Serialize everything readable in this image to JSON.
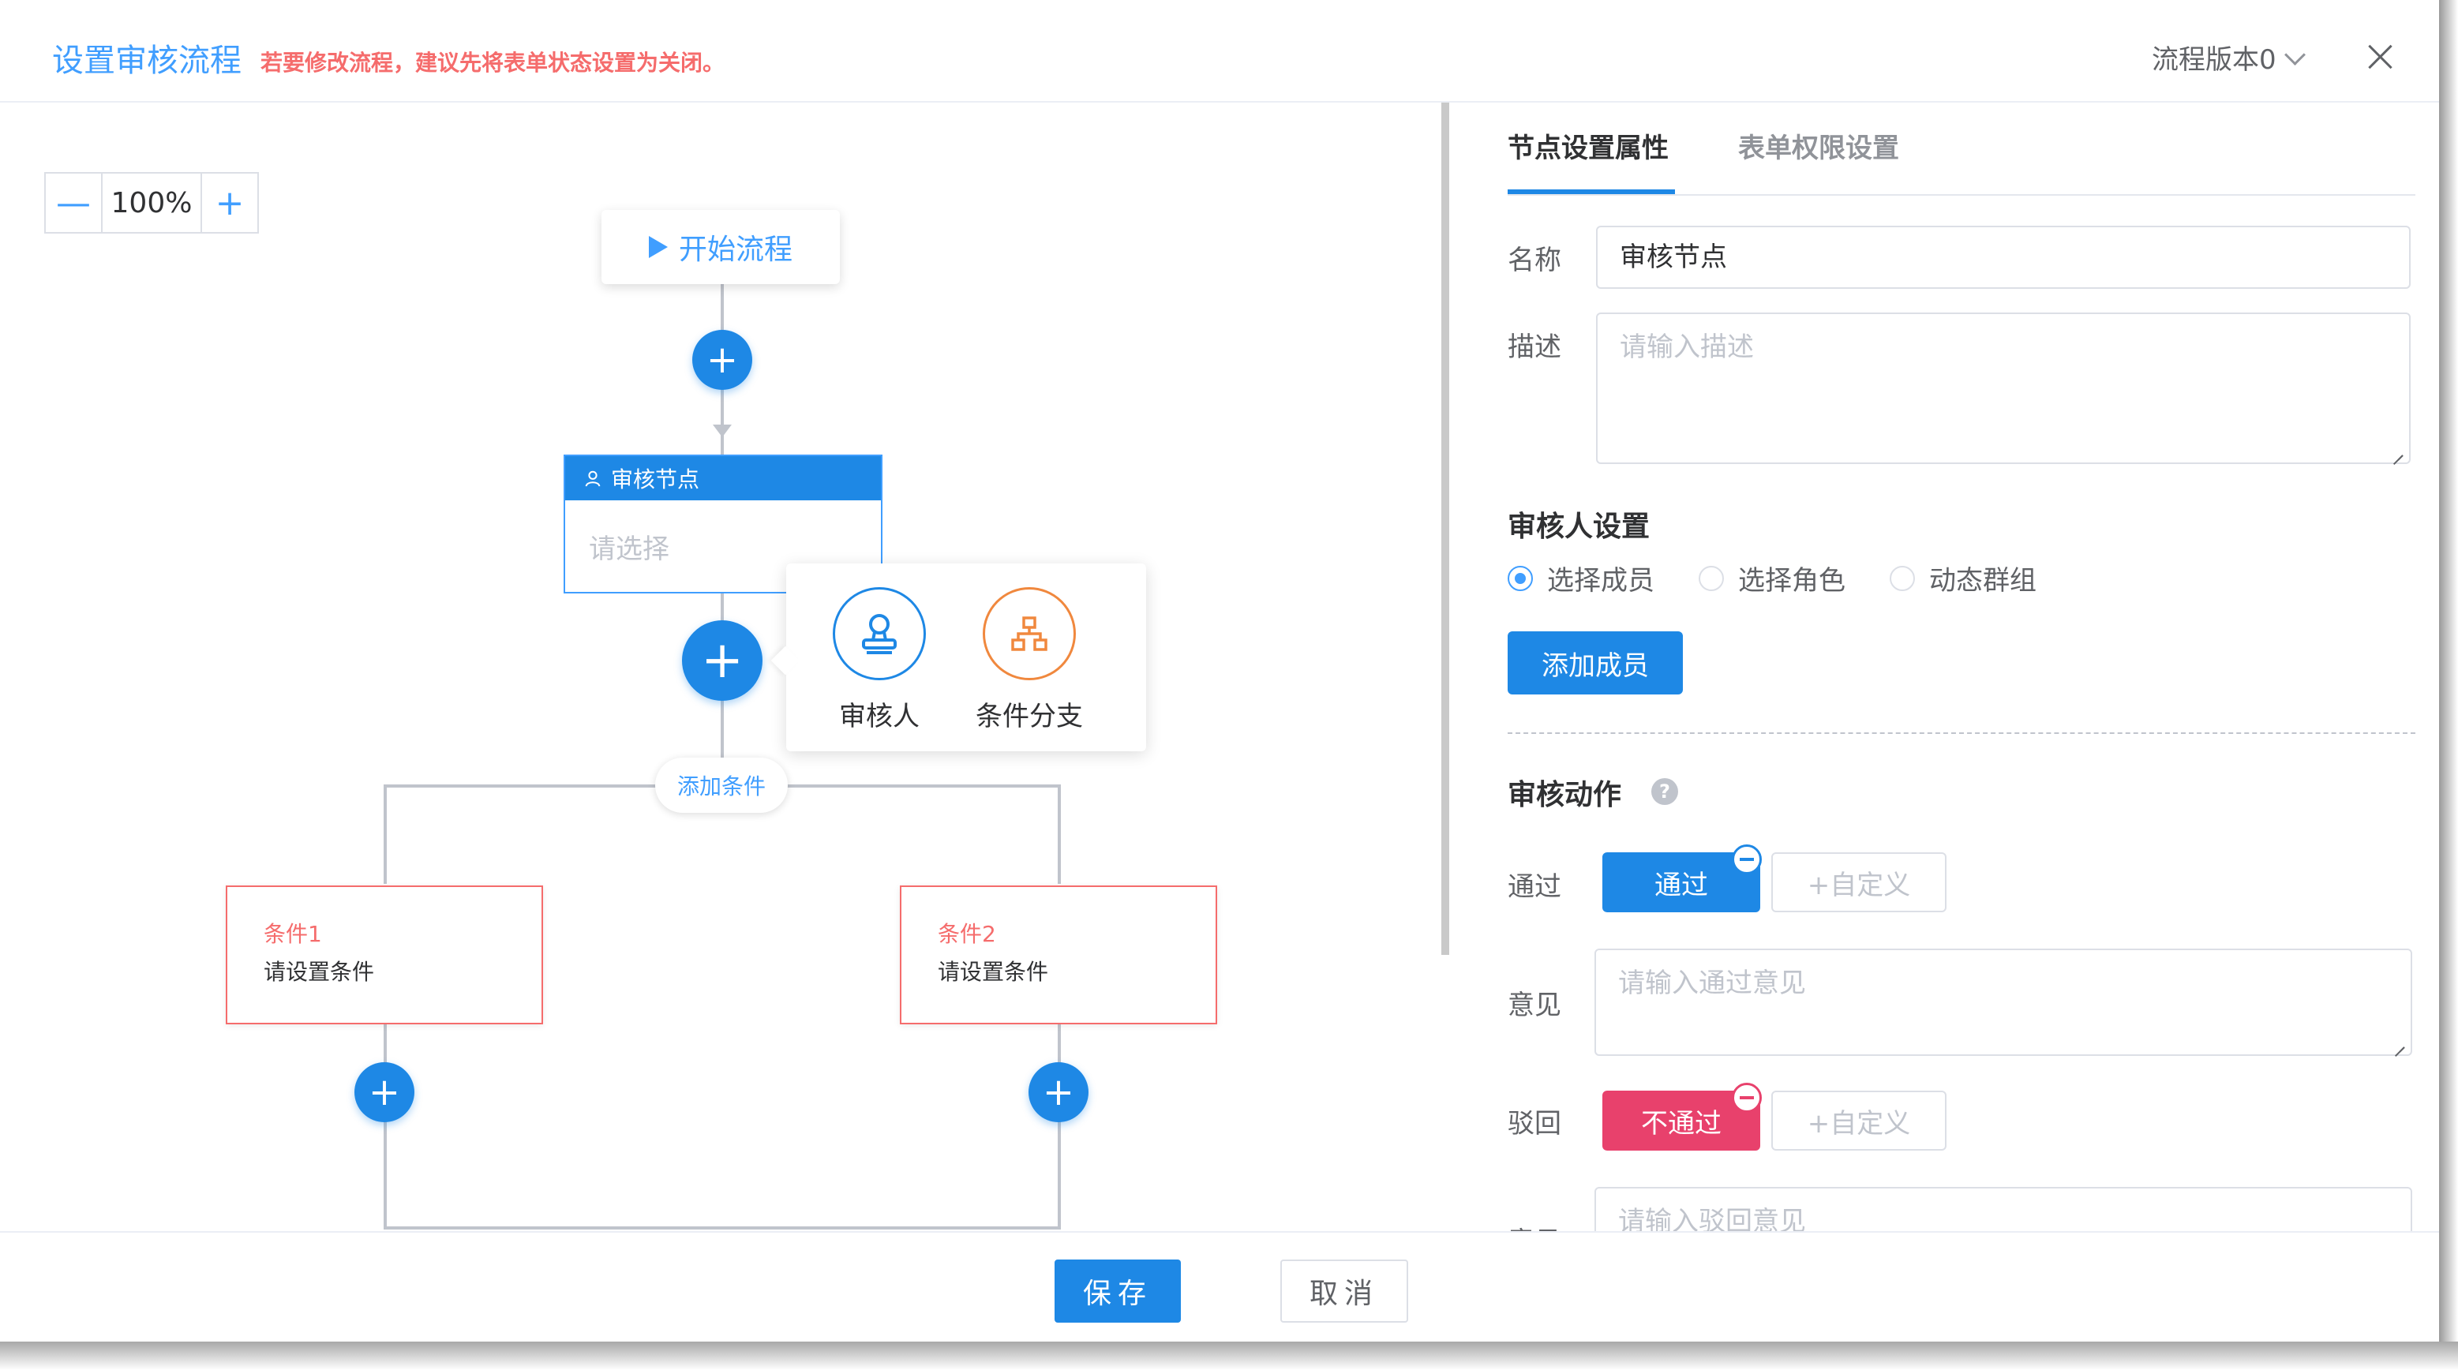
{
  "header": {
    "title": "设置审核流程",
    "warning": "若要修改流程，建议先将表单状态设置为关闭。",
    "version_label": "流程版本0"
  },
  "canvas": {
    "zoom": {
      "minus": "—",
      "value": "100%",
      "plus": "+"
    },
    "start_node": {
      "label": "开始流程"
    },
    "audit_node": {
      "title": "审核节点",
      "placeholder": "请选择"
    },
    "popover": {
      "items": [
        {
          "label": "审核人",
          "icon": "stamp-icon"
        },
        {
          "label": "条件分支",
          "icon": "branch-icon"
        }
      ]
    },
    "add_condition_label": "添加条件",
    "conditions": [
      {
        "title": "条件1",
        "desc": "请设置条件"
      },
      {
        "title": "条件2",
        "desc": "请设置条件"
      }
    ],
    "colors": {
      "primary": "#1e88e5",
      "condition": "#f56c6c",
      "popover_orange": "#f0883e"
    }
  },
  "panel": {
    "tabs": [
      {
        "label": "节点设置属性",
        "active": true
      },
      {
        "label": "表单权限设置",
        "active": false
      }
    ],
    "name_label": "名称",
    "name_value": "审核节点",
    "desc_label": "描述",
    "desc_placeholder": "请输入描述",
    "reviewer_section": "审核人设置",
    "radios": [
      {
        "label": "选择成员",
        "checked": true
      },
      {
        "label": "选择角色",
        "checked": false
      },
      {
        "label": "动态群组",
        "checked": false
      }
    ],
    "add_member_button": "添加成员",
    "action_section": "审核动作",
    "help_glyph": "?",
    "pass": {
      "label": "通过",
      "tag": "通过",
      "custom": "+自定义",
      "opinion_label": "意见",
      "opinion_placeholder": "请输入通过意见"
    },
    "reject": {
      "label": "驳回",
      "tag": "不通过",
      "custom": "+自定义",
      "opinion_label": "意见",
      "opinion_placeholder": "请输入驳回意见"
    },
    "colors": {
      "reject": "#e8416c"
    }
  },
  "footer": {
    "save": "保存",
    "cancel": "取消"
  }
}
